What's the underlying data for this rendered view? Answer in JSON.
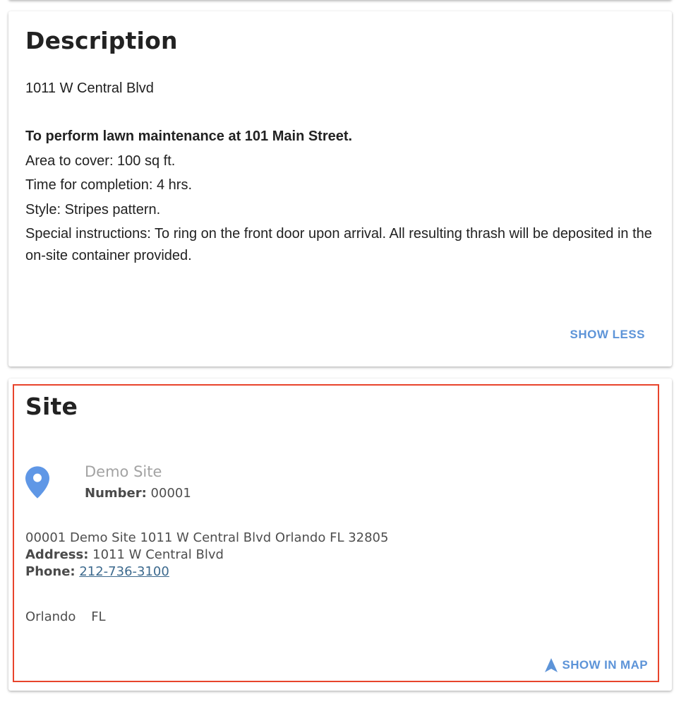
{
  "colors": {
    "accent": "#5d94d8",
    "highlight_border": "#e8442c",
    "phone_link": "#3d6a8e",
    "pin": "#5f97e6"
  },
  "description": {
    "title": "Description",
    "address": "1011 W Central Blvd",
    "lead": "To perform lawn maintenance at 101 Main Street.",
    "lines": [
      "Area to cover: 100 sq ft.",
      "Time for completion: 4 hrs.",
      "Style: Stripes pattern.",
      "Special instructions: To ring on the front door upon arrival. All resulting thrash will be deposited in the on-site container provided."
    ],
    "show_less_label": "SHOW LESS"
  },
  "site": {
    "title": "Site",
    "icon": "map-pin-icon",
    "name": "Demo Site",
    "number_label": "Number:",
    "number": "00001",
    "full_address": "00001 Demo Site 1011 W Central Blvd Orlando FL 32805",
    "address_label": "Address:",
    "address": "1011 W Central Blvd",
    "phone_label": "Phone:",
    "phone": "212-736-3100",
    "city": "Orlando",
    "state": "FL",
    "show_in_map_icon": "navigation-arrow-icon",
    "show_in_map_label": "SHOW IN MAP"
  }
}
